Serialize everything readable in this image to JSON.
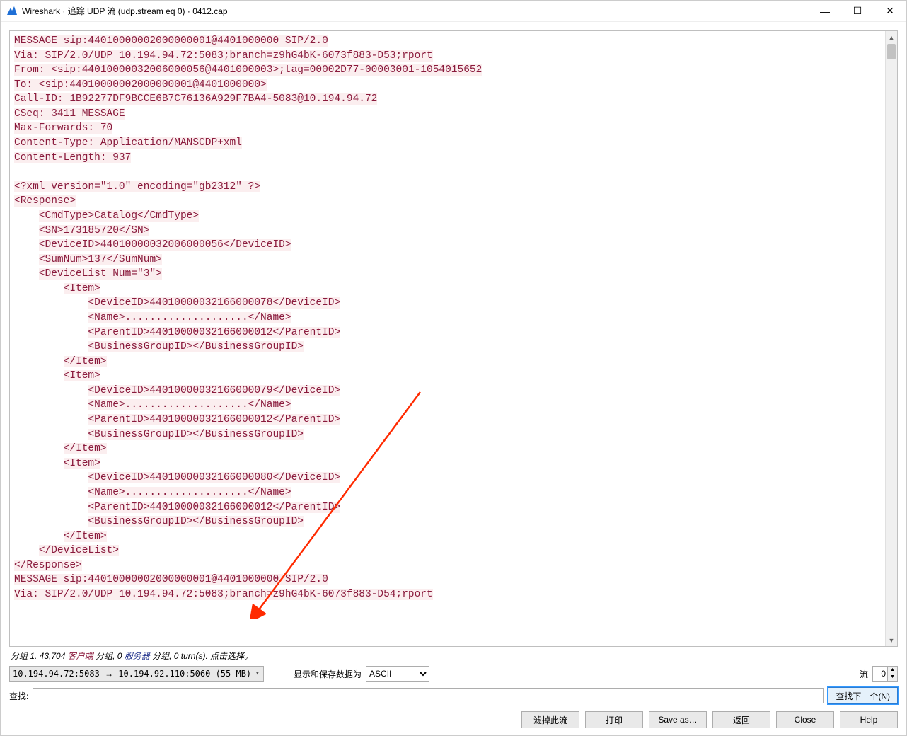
{
  "titlebar": {
    "app_name": "Wireshark",
    "subtitle": "追踪 UDP 流 (udp.stream eq 0)",
    "capture_file": "0412.cap"
  },
  "window_controls": {
    "min": "—",
    "max": "☐",
    "close": "✕"
  },
  "stream_lines": [
    "MESSAGE sip:44010000002000000001@4401000000 SIP/2.0",
    "Via: SIP/2.0/UDP 10.194.94.72:5083;branch=z9hG4bK-6073f883-D53;rport",
    "From: <sip:44010000032006000056@4401000003>;tag=00002D77-00003001-1054015652",
    "To: <sip:44010000002000000001@4401000000>",
    "Call-ID: 1B92277DF9BCCE6B7C76136A929F7BA4-5083@10.194.94.72",
    "CSeq: 3411 MESSAGE",
    "Max-Forwards: 70",
    "Content-Type: Application/MANSCDP+xml",
    "Content-Length: 937",
    "",
    "<?xml version=\"1.0\" encoding=\"gb2312\" ?>",
    "<Response>",
    "    <CmdType>Catalog</CmdType>",
    "    <SN>173185720</SN>",
    "    <DeviceID>44010000032006000056</DeviceID>",
    "    <SumNum>137</SumNum>",
    "    <DeviceList Num=\"3\">",
    "        <Item>",
    "            <DeviceID>44010000032166000078</DeviceID>",
    "            <Name>....................</Name>",
    "            <ParentID>44010000032166000012</ParentID>",
    "            <BusinessGroupID></BusinessGroupID>",
    "        </Item>",
    "        <Item>",
    "            <DeviceID>44010000032166000079</DeviceID>",
    "            <Name>....................</Name>",
    "            <ParentID>44010000032166000012</ParentID>",
    "            <BusinessGroupID></BusinessGroupID>",
    "        </Item>",
    "        <Item>",
    "            <DeviceID>44010000032166000080</DeviceID>",
    "            <Name>....................</Name>",
    "            <ParentID>44010000032166000012</ParentID>",
    "            <BusinessGroupID></BusinessGroupID>",
    "        </Item>",
    "    </DeviceList>",
    "</Response>",
    "MESSAGE sip:44010000002000000001@4401000000 SIP/2.0",
    "Via: SIP/2.0/UDP 10.194.94.72:5083;branch=z9hG4bK-6073f883-D54;rport"
  ],
  "status": {
    "prefix": "分组 1. 43,704 ",
    "client_label": "客户端",
    "mid1": " 分组, 0 ",
    "server_label": "服务器",
    "mid2": " 分组, 0 turn(s). 点击选择。"
  },
  "conversation_combo": {
    "src": "10.194.94.72:5083",
    "arrow": "→",
    "dst": "10.194.92.110:5060",
    "size": "(55 MB)"
  },
  "display_save_label": "显示和保存数据为",
  "ascii_value": "ASCII",
  "stream_label": "流",
  "stream_index": "0",
  "find": {
    "label": "查找:",
    "value": "",
    "next_label": "查找下一个(N)"
  },
  "buttons": {
    "filter_out": "滤掉此流",
    "print": "打印",
    "save_as": "Save as…",
    "back": "返回",
    "close": "Close",
    "help": "Help"
  }
}
